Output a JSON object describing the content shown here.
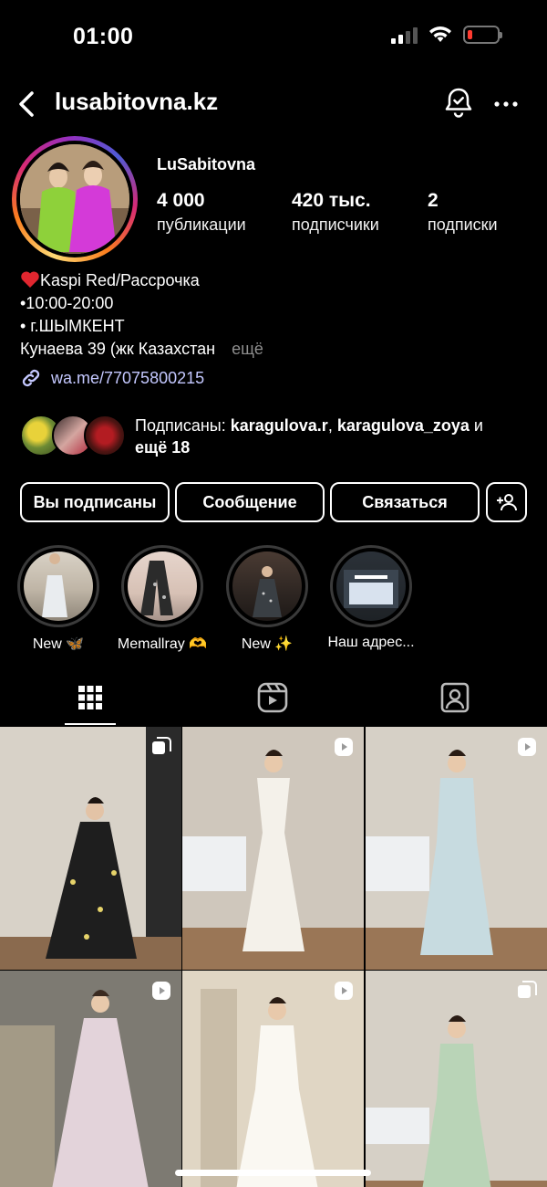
{
  "status_bar": {
    "time": "01:00"
  },
  "header": {
    "username": "lusabitovna.kz"
  },
  "profile": {
    "display_name": "LuSabitovna",
    "stats": [
      {
        "value": "4 000",
        "label": "публикации"
      },
      {
        "value": "420 тыс.",
        "label": "подписчики"
      },
      {
        "value": "2",
        "label": "подписки"
      }
    ]
  },
  "bio": {
    "line1": "Kaspi Red/Рассрочка",
    "line2": "•10:00-20:00",
    "line3": "• г.ШЫМКЕНТ",
    "line4": "Кунаева 39 (жк Казахстан",
    "more": "ещё",
    "link": "wa.me/77075800215"
  },
  "followed_by": {
    "prefix": "Подписаны: ",
    "user1": "karagulova.r",
    "sep": ", ",
    "user2": "karagulova_zoya",
    "and": " и",
    "rest": "ещё 18"
  },
  "buttons": {
    "following": "Вы подписаны",
    "message": "Сообщение",
    "contact": "Связаться"
  },
  "highlights": [
    {
      "label": "New 🦋"
    },
    {
      "label": "Memallray 🫶"
    },
    {
      "label": "New ✨"
    },
    {
      "label": "Наш адрес..."
    }
  ],
  "colors": {
    "background": "#000000",
    "link": "#c4c8ff",
    "muted": "#8e8e8e",
    "battery_low": "#ff3b30"
  },
  "posts": [
    {
      "type": "carousel"
    },
    {
      "type": "reel"
    },
    {
      "type": "reel"
    },
    {
      "type": "reel"
    },
    {
      "type": "reel"
    },
    {
      "type": "carousel"
    }
  ]
}
